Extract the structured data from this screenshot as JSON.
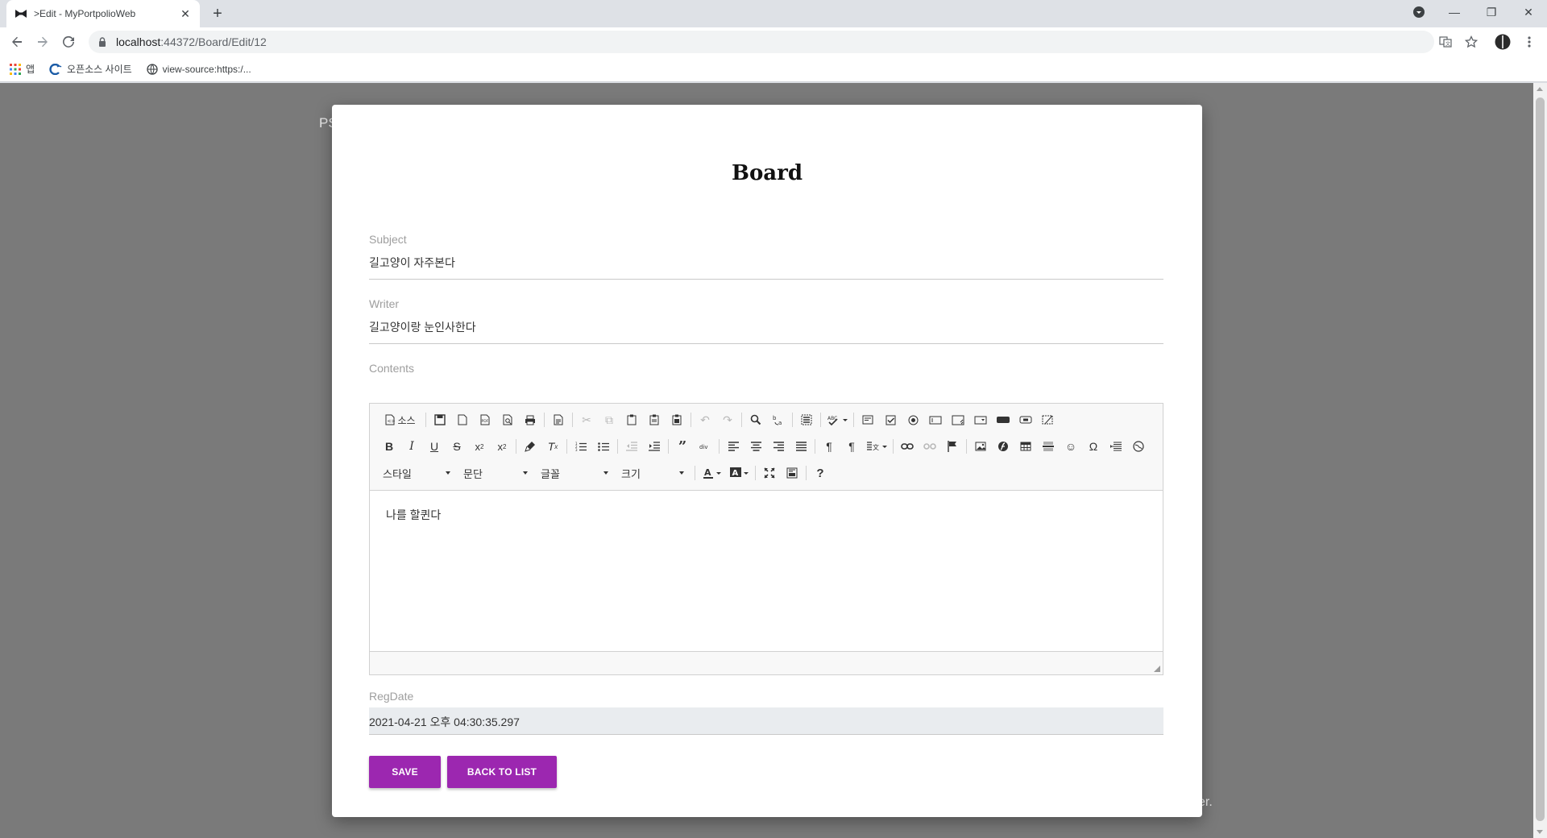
{
  "browser": {
    "tab_title": ">Edit - MyPortpolioWeb",
    "url_host": "localhost",
    "url_path": ":44372/Board/Edit/12",
    "bookmarks": [
      {
        "label": "앱",
        "icon": "apps-grid-icon"
      },
      {
        "label": "오픈소스 사이트",
        "icon": "site-logo-icon"
      },
      {
        "label": "view-source:https:/...",
        "icon": "globe-icon"
      }
    ]
  },
  "page": {
    "bg_left_text": "PS",
    "bg_right_text": "er."
  },
  "form": {
    "title": "Board",
    "subject_label": "Subject",
    "subject_value": "길고양이 자주본다",
    "writer_label": "Writer",
    "writer_value": "길고양이랑 눈인사한다",
    "contents_label": "Contents",
    "contents_body": "나를 할퀸다",
    "regdate_label": "RegDate",
    "regdate_value": "2021-04-21 오후 04:30:35.297",
    "save_label": "SAVE",
    "back_label": "BACK TO LIST"
  },
  "editor": {
    "source_label": "소스",
    "style_combo": "스타일",
    "format_combo": "문단",
    "font_combo": "글꼴",
    "size_combo": "크기"
  },
  "colors": {
    "button": "#9c27b0",
    "backdrop": "#7a7a7a"
  }
}
